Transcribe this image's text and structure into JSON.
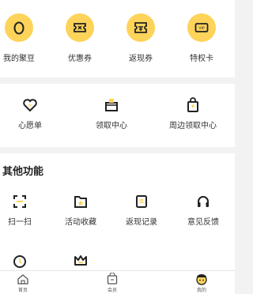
{
  "top_shortcuts": [
    {
      "label": "我的聚豆",
      "icon": "bean-icon"
    },
    {
      "label": "优惠券",
      "icon": "coupon-icon"
    },
    {
      "label": "返现券",
      "icon": "cashback-coupon-icon"
    },
    {
      "label": "特权卡",
      "icon": "vip-card-icon"
    }
  ],
  "services": [
    {
      "label": "心愿单",
      "icon": "heart-icon"
    },
    {
      "label": "领取中心",
      "icon": "gift-box-icon"
    },
    {
      "label": "周边领取中心",
      "icon": "shopping-bag-icon"
    }
  ],
  "other": {
    "title": "其他功能",
    "items": [
      {
        "label": "扫一扫",
        "icon": "scan-icon"
      },
      {
        "label": "活动收藏",
        "icon": "favorite-folder-icon"
      },
      {
        "label": "返现记录",
        "icon": "record-icon"
      },
      {
        "label": "意见反馈",
        "icon": "headset-icon"
      },
      {
        "label": "",
        "icon": "clock-icon"
      },
      {
        "label": "",
        "icon": "crown-icon"
      }
    ]
  },
  "tabbar": [
    {
      "label": "首页",
      "icon": "home-icon"
    },
    {
      "label": "会员",
      "icon": "member-icon"
    },
    {
      "label": "我的",
      "icon": "profile-icon"
    }
  ],
  "colors": {
    "accent": "#fdd35a",
    "icon_stroke": "#222222"
  }
}
